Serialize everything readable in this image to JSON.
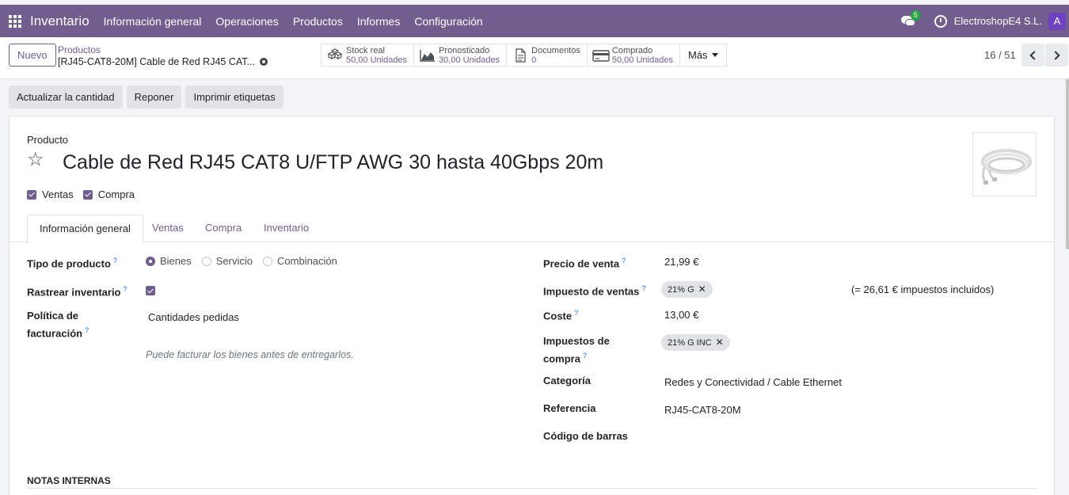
{
  "topbar": {
    "app_name": "Inventario",
    "menu": [
      "Información general",
      "Operaciones",
      "Productos",
      "Informes",
      "Configuración"
    ],
    "chat_badge": "5",
    "company": "ElectroshopE4 S.L.",
    "avatar_letter": "A",
    "bg_color": "#725d8f"
  },
  "control_panel": {
    "new_label": "Nuevo",
    "breadcrumb_parent": "Productos",
    "breadcrumb_current": "[RJ45-CAT8-20M] Cable de Red RJ45 CAT...",
    "stats": [
      {
        "label": "Stock real",
        "value": "50,00 Unidades",
        "icon": "cubes-icon"
      },
      {
        "label": "Pronosticado",
        "value": "30,00 Unidades",
        "icon": "area-chart-icon"
      },
      {
        "label": "Documentos",
        "value": "0",
        "icon": "document-icon"
      },
      {
        "label": "Comprado",
        "value": "50,00 Unidades",
        "icon": "credit-card-icon"
      }
    ],
    "more_label": "Más",
    "pager": "16 / 51"
  },
  "actions": [
    "Actualizar la cantidad",
    "Reponer",
    "Imprimir etiquetas"
  ],
  "product": {
    "label": "Producto",
    "name": "Cable de Red RJ45 CAT8 U/FTP AWG 30 hasta 40Gbps 20m",
    "can_be_sold_label": "Ventas",
    "can_be_purchased_label": "Compra"
  },
  "tabs": [
    "Información general",
    "Ventas",
    "Compra",
    "Inventario"
  ],
  "left_fields": {
    "product_type_label": "Tipo de producto",
    "product_type_options": [
      "Bienes",
      "Servicio",
      "Combinación"
    ],
    "product_type_selected": "Bienes",
    "track_inventory_label": "Rastrear inventario",
    "invoice_policy_label_1": "Política de",
    "invoice_policy_label_2": "facturación",
    "invoice_policy_value": "Cantidades pedidas",
    "invoice_policy_help": "Puede facturar los bienes antes de entregarlos."
  },
  "right_fields": {
    "sale_price_label": "Precio de venta",
    "sale_price_value": "21,99 €",
    "sales_tax_label": "Impuesto de ventas",
    "sales_tax_tag": "21% G",
    "tax_included_note": "(= 26,61 € impuestos incluidos)",
    "cost_label": "Coste",
    "cost_value": "13,00 €",
    "purchase_tax_label_1": "Impuestos de",
    "purchase_tax_label_2": "compra",
    "purchase_tax_tag": "21% G INC",
    "category_label": "Categoría",
    "category_value": "Redes y Conectividad / Cable Ethernet",
    "reference_label": "Referencia",
    "reference_value": "RJ45-CAT8-20M",
    "barcode_label": "Código de barras"
  },
  "notes_label": "NOTAS INTERNAS"
}
